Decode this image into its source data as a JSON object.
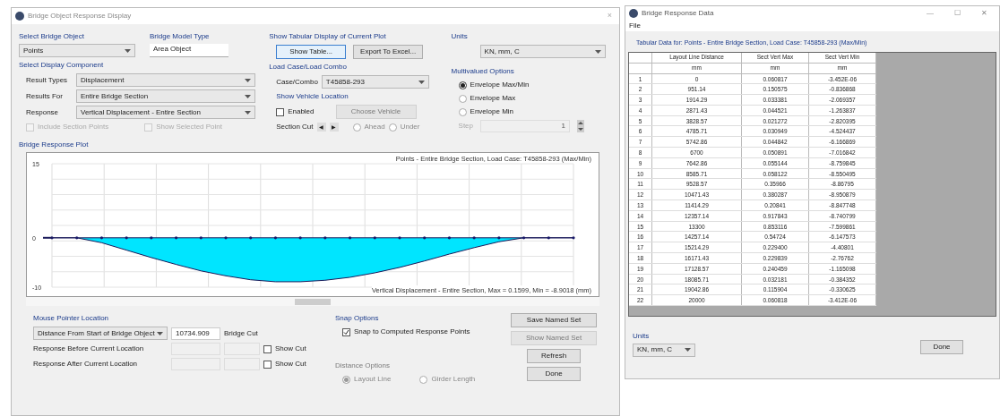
{
  "main_window": {
    "title": "Bridge Object Response Display",
    "close": "×",
    "bridge_object": {
      "label": "Select Bridge Object",
      "value": "Points"
    },
    "model_type": {
      "label": "Bridge Model Type",
      "value": "Area Object"
    },
    "tabular": {
      "label": "Show Tabular Display of Current Plot",
      "buttons": [
        {
          "label": "Show Table...",
          "focused": true
        },
        {
          "label": "Export To Excel...",
          "focused": false
        }
      ]
    },
    "units": {
      "label": "Units",
      "value": "KN, mm, C"
    },
    "display_component": {
      "label": "Select Display Component",
      "fields": [
        {
          "label": "Result Types",
          "value": "Displacement"
        },
        {
          "label": "Results For",
          "value": "Entire Bridge Section"
        },
        {
          "label": "Response",
          "value": "Vertical Displacement - Entire Section"
        }
      ],
      "checks": [
        {
          "label": "Include Section Points",
          "checked": false,
          "disabled": true
        },
        {
          "label": "Show Selected Point",
          "checked": false,
          "disabled": true
        }
      ]
    },
    "load_case": {
      "label": "Load Case/Load Combo",
      "combo_label": "Case/Combo",
      "combo_value": "T45858-293",
      "vehicle_label": "Show Vehicle Location",
      "enabled": {
        "label": "Enabled",
        "checked": false
      },
      "choose_button": {
        "label": "Choose Vehicle",
        "disabled": true
      },
      "section_cut_label": "Section Cut",
      "steppers": [
        "◀",
        "▶"
      ],
      "radios": [
        {
          "label": "Ahead",
          "selected": false
        },
        {
          "label": "Under",
          "selected": false
        }
      ]
    },
    "multivalued": {
      "label": "Multivalued Options",
      "options": [
        {
          "label": "Envelope Max/Min",
          "selected": true
        },
        {
          "label": "Envelope Max",
          "selected": false
        },
        {
          "label": "Envelope Min",
          "selected": false
        }
      ],
      "step": {
        "label": "Step",
        "value": "1",
        "disabled": true
      }
    },
    "plot": {
      "label": "Bridge Response Plot",
      "title": "Points - Entire Bridge Section,  Load Case: T45858-293 (Max/Min)",
      "footer": "Vertical Displacement - Entire Section,  Max = 0.1599,  Min = -8.9018  (mm)",
      "chart_data": {
        "type": "area",
        "series": [
          {
            "color": "#00e5ff",
            "values": [
              0,
              0,
              -1.0,
              -2.5,
              -4.0,
              -5.4,
              -6.7,
              -7.7,
              -8.5,
              -8.9,
              -8.9,
              -8.6,
              -8.0,
              -7.1,
              -6.0,
              -4.7,
              -3.3,
              -2.0,
              -0.8,
              0,
              0,
              0
            ]
          }
        ],
        "ylim": [
          -10,
          15
        ],
        "yticks": [
          15,
          0,
          -10
        ]
      }
    },
    "mouse_pointer": {
      "label": "Mouse Pointer Location",
      "mode": "Distance From Start of Bridge Object",
      "value": "10734.909",
      "unit": "Bridge Cut",
      "rows": [
        {
          "label": "Response Before Current Location",
          "show_cut": {
            "label": "Show Cut",
            "checked": false
          }
        },
        {
          "label": "Response After Current Location",
          "show_cut": {
            "label": "Show Cut",
            "checked": false
          }
        }
      ]
    },
    "snap": {
      "label": "Snap Options",
      "option": {
        "label": "Snap to Computed Response Points",
        "checked": true
      }
    },
    "distance": {
      "label": "Distance Options",
      "disabled": true,
      "options": [
        {
          "label": "Layout Line",
          "selected": true
        },
        {
          "label": "Girder Length",
          "selected": false
        }
      ]
    },
    "buttons": [
      {
        "label": "Save Named Set",
        "disabled": false
      },
      {
        "label": "Show Named Set",
        "disabled": true
      },
      {
        "label": "Refresh",
        "disabled": false
      },
      {
        "label": "Done",
        "disabled": false
      }
    ]
  },
  "data_window": {
    "title": "Bridge Response Data",
    "controls": [
      "—",
      "☐",
      "✕"
    ],
    "menu": [
      "File"
    ],
    "caption": "Tabular Data for:  Points - Entire Bridge Section,  Load Case: T45858-293 (Max/Min)",
    "table": {
      "columns": [
        "",
        "Layout Line Distance",
        "Sect Vert Max",
        "Sect Vert Min"
      ],
      "units": [
        "mm",
        "mm",
        "mm"
      ],
      "rows": [
        [
          "1",
          "0",
          "0.060817",
          "-3.452E-06"
        ],
        [
          "2",
          "951.14",
          "0.150575",
          "-0.836868"
        ],
        [
          "3",
          "1914.29",
          "0.033381",
          "-2.069357"
        ],
        [
          "4",
          "2871.43",
          "0.044521",
          "-1.263837"
        ],
        [
          "5",
          "3828.57",
          "0.021272",
          "-2.820395"
        ],
        [
          "6",
          "4785.71",
          "0.030949",
          "-4.524437"
        ],
        [
          "7",
          "5742.86",
          "0.044842",
          "-6.166869"
        ],
        [
          "8",
          "6700",
          "0.050891",
          "-7.016842"
        ],
        [
          "9",
          "7642.86",
          "0.055144",
          "-8.759845"
        ],
        [
          "10",
          "8585.71",
          "0.058122",
          "-8.550495"
        ],
        [
          "11",
          "9528.57",
          "0.35966",
          "-8.86795"
        ],
        [
          "12",
          "10471.43",
          "0.380287",
          "-8.950879"
        ],
        [
          "13",
          "11414.29",
          "0.20841",
          "-8.847748"
        ],
        [
          "14",
          "12357.14",
          "0.917843",
          "-8.740799"
        ],
        [
          "15",
          "13300",
          "0.853116",
          "-7.599861"
        ],
        [
          "16",
          "14257.14",
          "0.54724",
          "-6.147573"
        ],
        [
          "17",
          "15214.29",
          "0.229400",
          "-4.40801"
        ],
        [
          "18",
          "16171.43",
          "0.229839",
          "-2.76762"
        ],
        [
          "19",
          "17128.57",
          "0.240459",
          "-1.165098"
        ],
        [
          "20",
          "18085.71",
          "0.032181",
          "-0.384352"
        ],
        [
          "21",
          "19042.86",
          "0.115904",
          "-0.330625"
        ],
        [
          "22",
          "20000",
          "0.060818",
          "-3.412E-06"
        ]
      ]
    },
    "units": {
      "label": "Units",
      "value": "KN, mm, C"
    },
    "done": "Done"
  }
}
